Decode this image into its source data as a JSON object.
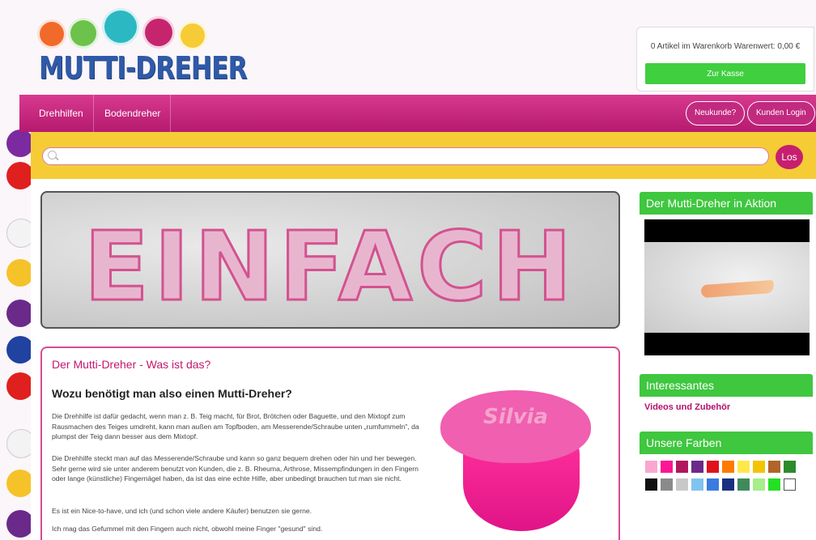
{
  "header": {
    "logo_text": "MUTTI-DREHER",
    "cart_info": "0  Artikel im Warenkorb Warenwert: 0,00 €",
    "checkout_label": "Zur Kasse"
  },
  "nav": {
    "items": [
      {
        "label": "Drehhilfen"
      },
      {
        "label": "Bodendreher"
      }
    ],
    "new_customer_label": "Neukunde?",
    "login_label": "Kunden Login"
  },
  "search": {
    "placeholder": "",
    "button_label": "Los"
  },
  "banner": {
    "text": "EINFACH"
  },
  "content": {
    "title": "Der Mutti-Dreher - Was ist das?",
    "subtitle": "Wozu benötigt man also einen Mutti-Dreher?",
    "paragraphs": [
      "Die Drehhilfe ist dafür gedacht, wenn man z. B. Teig macht, für Brot, Brötchen oder Baguette, und den Mixtopf zum Rausmachen des Teiges umdreht, kann man außen am Topfboden, am Messerende/Schraube unten „rumfummeln\", da plumpst der Teig dann besser aus dem Mixtopf.",
      "Die Drehhilfe steckt man auf das Messerende/Schraube und kann so ganz bequem drehen oder hin und her bewegen. Sehr gerne wird sie unter anderem benutzt von Kunden, die z. B. Rheuma, Arthrose, Missempfindungen in den Fingern oder lange (künstliche) Fingernägel haben, da ist das eine echte Hilfe, aber unbedingt brauchen tut man sie nicht.",
      "Es ist ein Nice-to-have, und ich (und schon viele andere Käufer) benutzen sie gerne.",
      "Ich mag das Gefummel mit den Fingern auch nicht, obwohl meine Finger \"gesund\" sind."
    ],
    "product_label": "Silvia"
  },
  "sidebar": {
    "video_title": "Der Mutti-Dreher in Aktion",
    "interesting_title": "Interessantes",
    "interesting_link": "Videos und Zubehör",
    "colors_title": "Unsere Farben",
    "colors": [
      "#f8a8d0",
      "#ff1493",
      "#b0185e",
      "#6b2a8a",
      "#e0121e",
      "#ff7a00",
      "#ffe84a",
      "#f2c500",
      "#b0652a",
      "#2c8b2c",
      "#111111",
      "#8a8a8a",
      "#c8c8c8",
      "#7fc4f0",
      "#3a7be0",
      "#1a2f80",
      "#3f8a5a",
      "#a6ee8a",
      "#23e023",
      "#ffffff"
    ]
  },
  "theme": {
    "accent": "#c71f6f",
    "green": "#3fc73f",
    "yellow": "#f6cc36",
    "blue": "#2f5aa8"
  }
}
